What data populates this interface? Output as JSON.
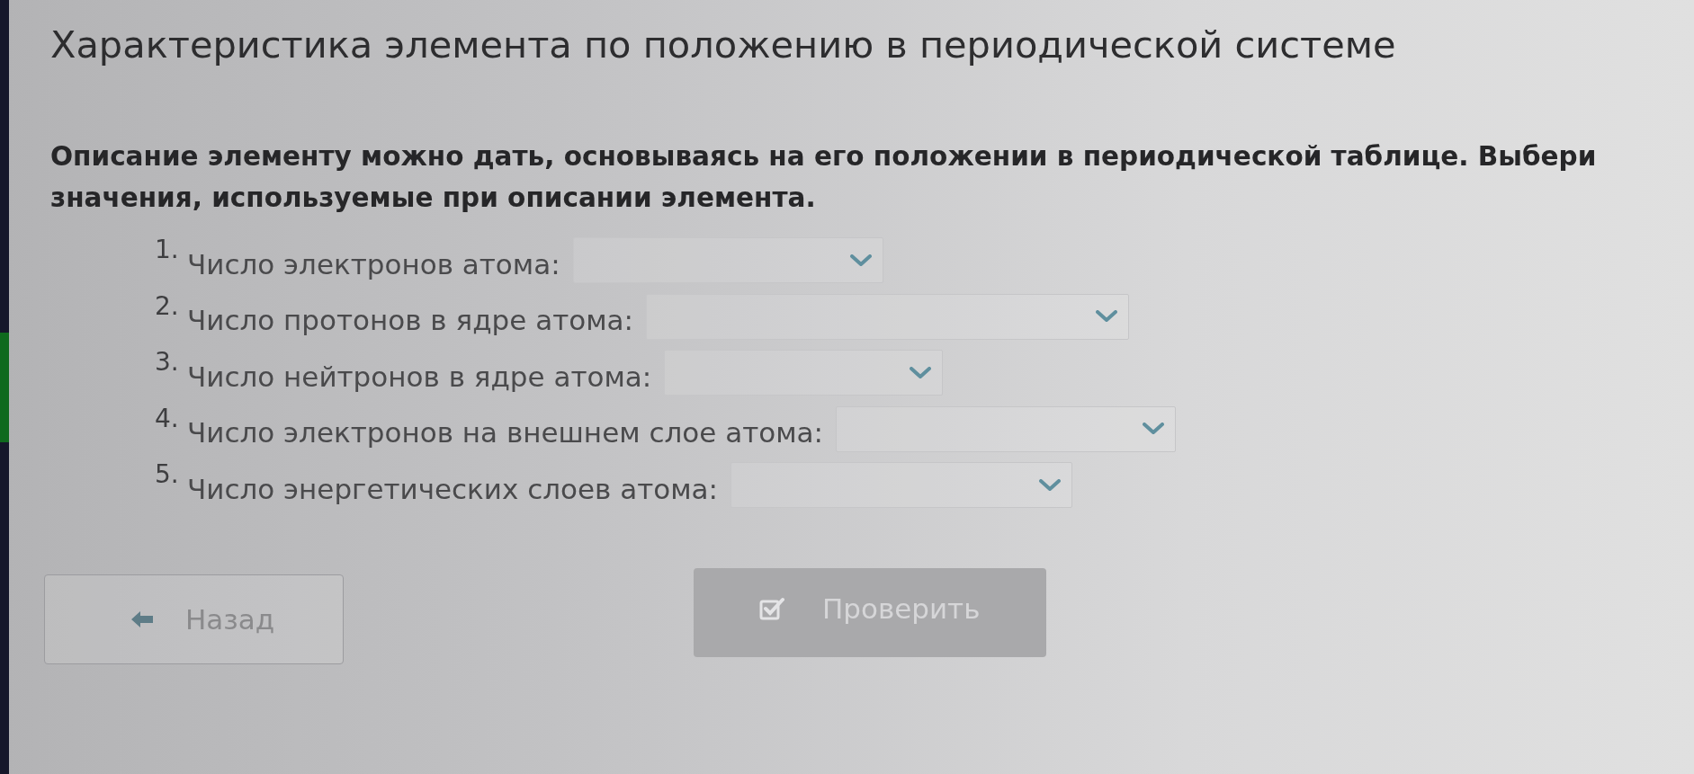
{
  "page": {
    "title": "Характеристика элемента по положению в периодической системе"
  },
  "question": {
    "prompt": "Описание элементу можно дать, основываясь на его положении в периодической таблице. Выбери значения, используемые при описании элемента.",
    "items": [
      {
        "number": "1.",
        "label": "Число электронов атома:"
      },
      {
        "number": "2.",
        "label": "Число протонов в ядре атома:"
      },
      {
        "number": "3.",
        "label": "Число нейтронов в ядре атома:"
      },
      {
        "number": "4.",
        "label": "Число электронов на внешнем слое атома:"
      },
      {
        "number": "5.",
        "label": "Число энергетических слоев атома:"
      }
    ]
  },
  "buttons": [
    {
      "kind": "back",
      "label": "Назад",
      "disabled": false
    },
    {
      "kind": "check",
      "label": "Проверить",
      "disabled": true
    }
  ]
}
